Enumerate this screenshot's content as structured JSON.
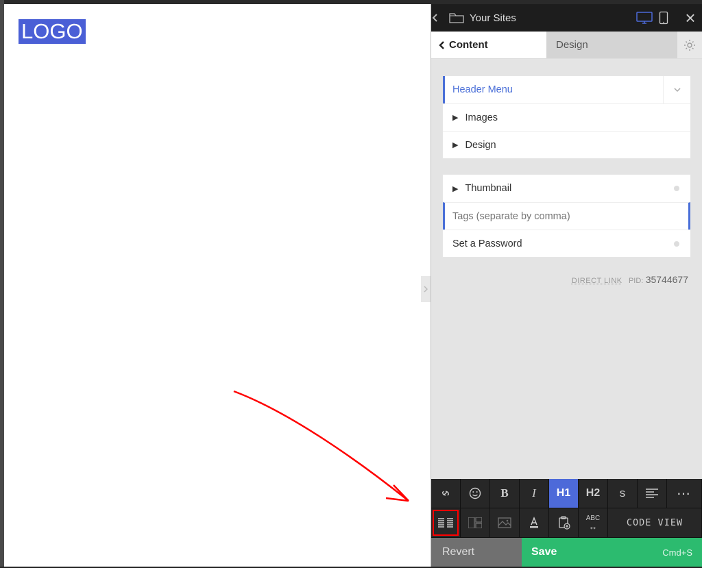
{
  "header": {
    "breadcrumb": "Your Sites"
  },
  "canvas": {
    "logo_text": "LOGO"
  },
  "tabs": {
    "content": "Content",
    "design": "Design"
  },
  "sections": {
    "header_menu": "Header Menu",
    "images": "Images",
    "design": "Design",
    "thumbnail": "Thumbnail",
    "tags_placeholder": "Tags (separate by comma)",
    "set_password": "Set a Password"
  },
  "meta": {
    "direct_link": "direct link",
    "pid_label": "PID:",
    "pid_value": "35744677"
  },
  "toolbar": {
    "bold": "B",
    "italic": "I",
    "h1": "H1",
    "h2": "H2",
    "strike": "s",
    "abc": "ABC",
    "abc_arrows": "↔",
    "code_view": "CODE VIEW"
  },
  "actions": {
    "revert": "Revert",
    "save": "Save",
    "save_shortcut": "Cmd+S"
  }
}
